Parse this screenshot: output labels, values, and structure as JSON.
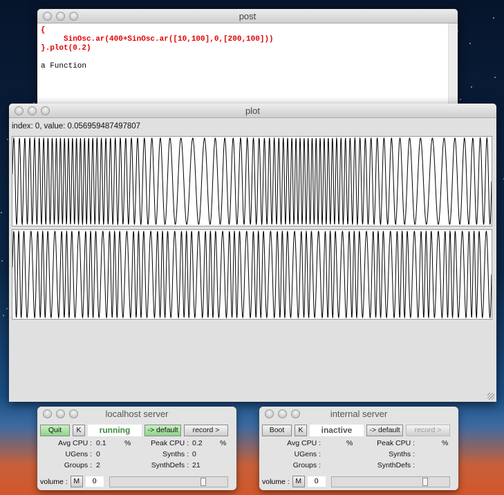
{
  "post_window": {
    "title": "post",
    "code_lines": [
      "{",
      "     SinOsc.ar(400+SinOsc.ar([10,100],0,[200,100]))",
      "}.plot(0.2)"
    ],
    "output": "a Function"
  },
  "plot_window": {
    "title": "plot",
    "index_readout": "index: 0, value: 0.056959487497807",
    "channels": [
      {
        "carrier_hz": 400,
        "mod_hz": 10,
        "mod_depth": 200
      },
      {
        "carrier_hz": 400,
        "mod_hz": 100,
        "mod_depth": 100
      }
    ],
    "duration_s": 0.2
  },
  "localhost_server": {
    "title": "localhost server",
    "boot_label": "Quit",
    "kill_label": "K",
    "status": "running",
    "default_label": "-> default",
    "record_label": "record >",
    "avg_cpu_label": "Avg CPU :",
    "avg_cpu": "0.1",
    "peak_cpu_label": "Peak CPU :",
    "peak_cpu": "0.2",
    "pct": "%",
    "ugens_label": "UGens :",
    "ugens": "0",
    "synths_label": "Synths :",
    "synths": "0",
    "groups_label": "Groups :",
    "groups": "2",
    "synthdefs_label": "SynthDefs :",
    "synthdefs": "21",
    "volume_label": "volume :",
    "mute_label": "M",
    "volume": "0",
    "volume_fraction": 0.77,
    "status_color": "#3c8a3c"
  },
  "internal_server": {
    "title": "internal server",
    "boot_label": "Boot",
    "kill_label": "K",
    "status": "inactive",
    "default_label": "-> default",
    "record_label": "record >",
    "avg_cpu_label": "Avg CPU :",
    "peak_cpu_label": "Peak CPU :",
    "pct": "%",
    "ugens_label": "UGens :",
    "synths_label": "Synths :",
    "groups_label": "Groups :",
    "synthdefs_label": "SynthDefs :",
    "volume_label": "volume :",
    "mute_label": "M",
    "volume": "0",
    "volume_fraction": 0.77,
    "status_color": "#555555"
  }
}
